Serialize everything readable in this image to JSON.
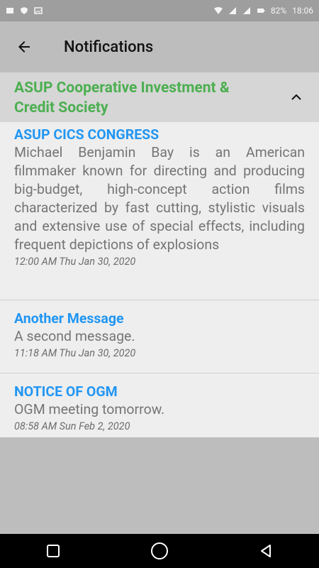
{
  "status_bar": {
    "battery": "82%",
    "time": "18:06"
  },
  "app_bar": {
    "title": "Notifications"
  },
  "group": {
    "title": "ASUP Cooperative Investment & Credit Society"
  },
  "messages": [
    {
      "title": "ASUP CICS CONGRESS",
      "body": "Michael Benjamin Bay is an American filmmaker known for directing and producing big-budget, high-concept action films characterized by fast cutting, stylistic visuals and extensive use of special effects, including frequent depictions of explosions",
      "time": "12:00 AM Thu Jan 30, 2020"
    },
    {
      "title": "Another Message",
      "body": "A second message.",
      "time": "11:18 AM Thu Jan 30, 2020"
    },
    {
      "title": "NOTICE OF OGM",
      "body": "OGM meeting tomorrow.",
      "time": "08:58 AM Sun Feb 2, 2020"
    }
  ],
  "colors": {
    "group_title": "#4caf50",
    "message_title": "#2196f3"
  }
}
